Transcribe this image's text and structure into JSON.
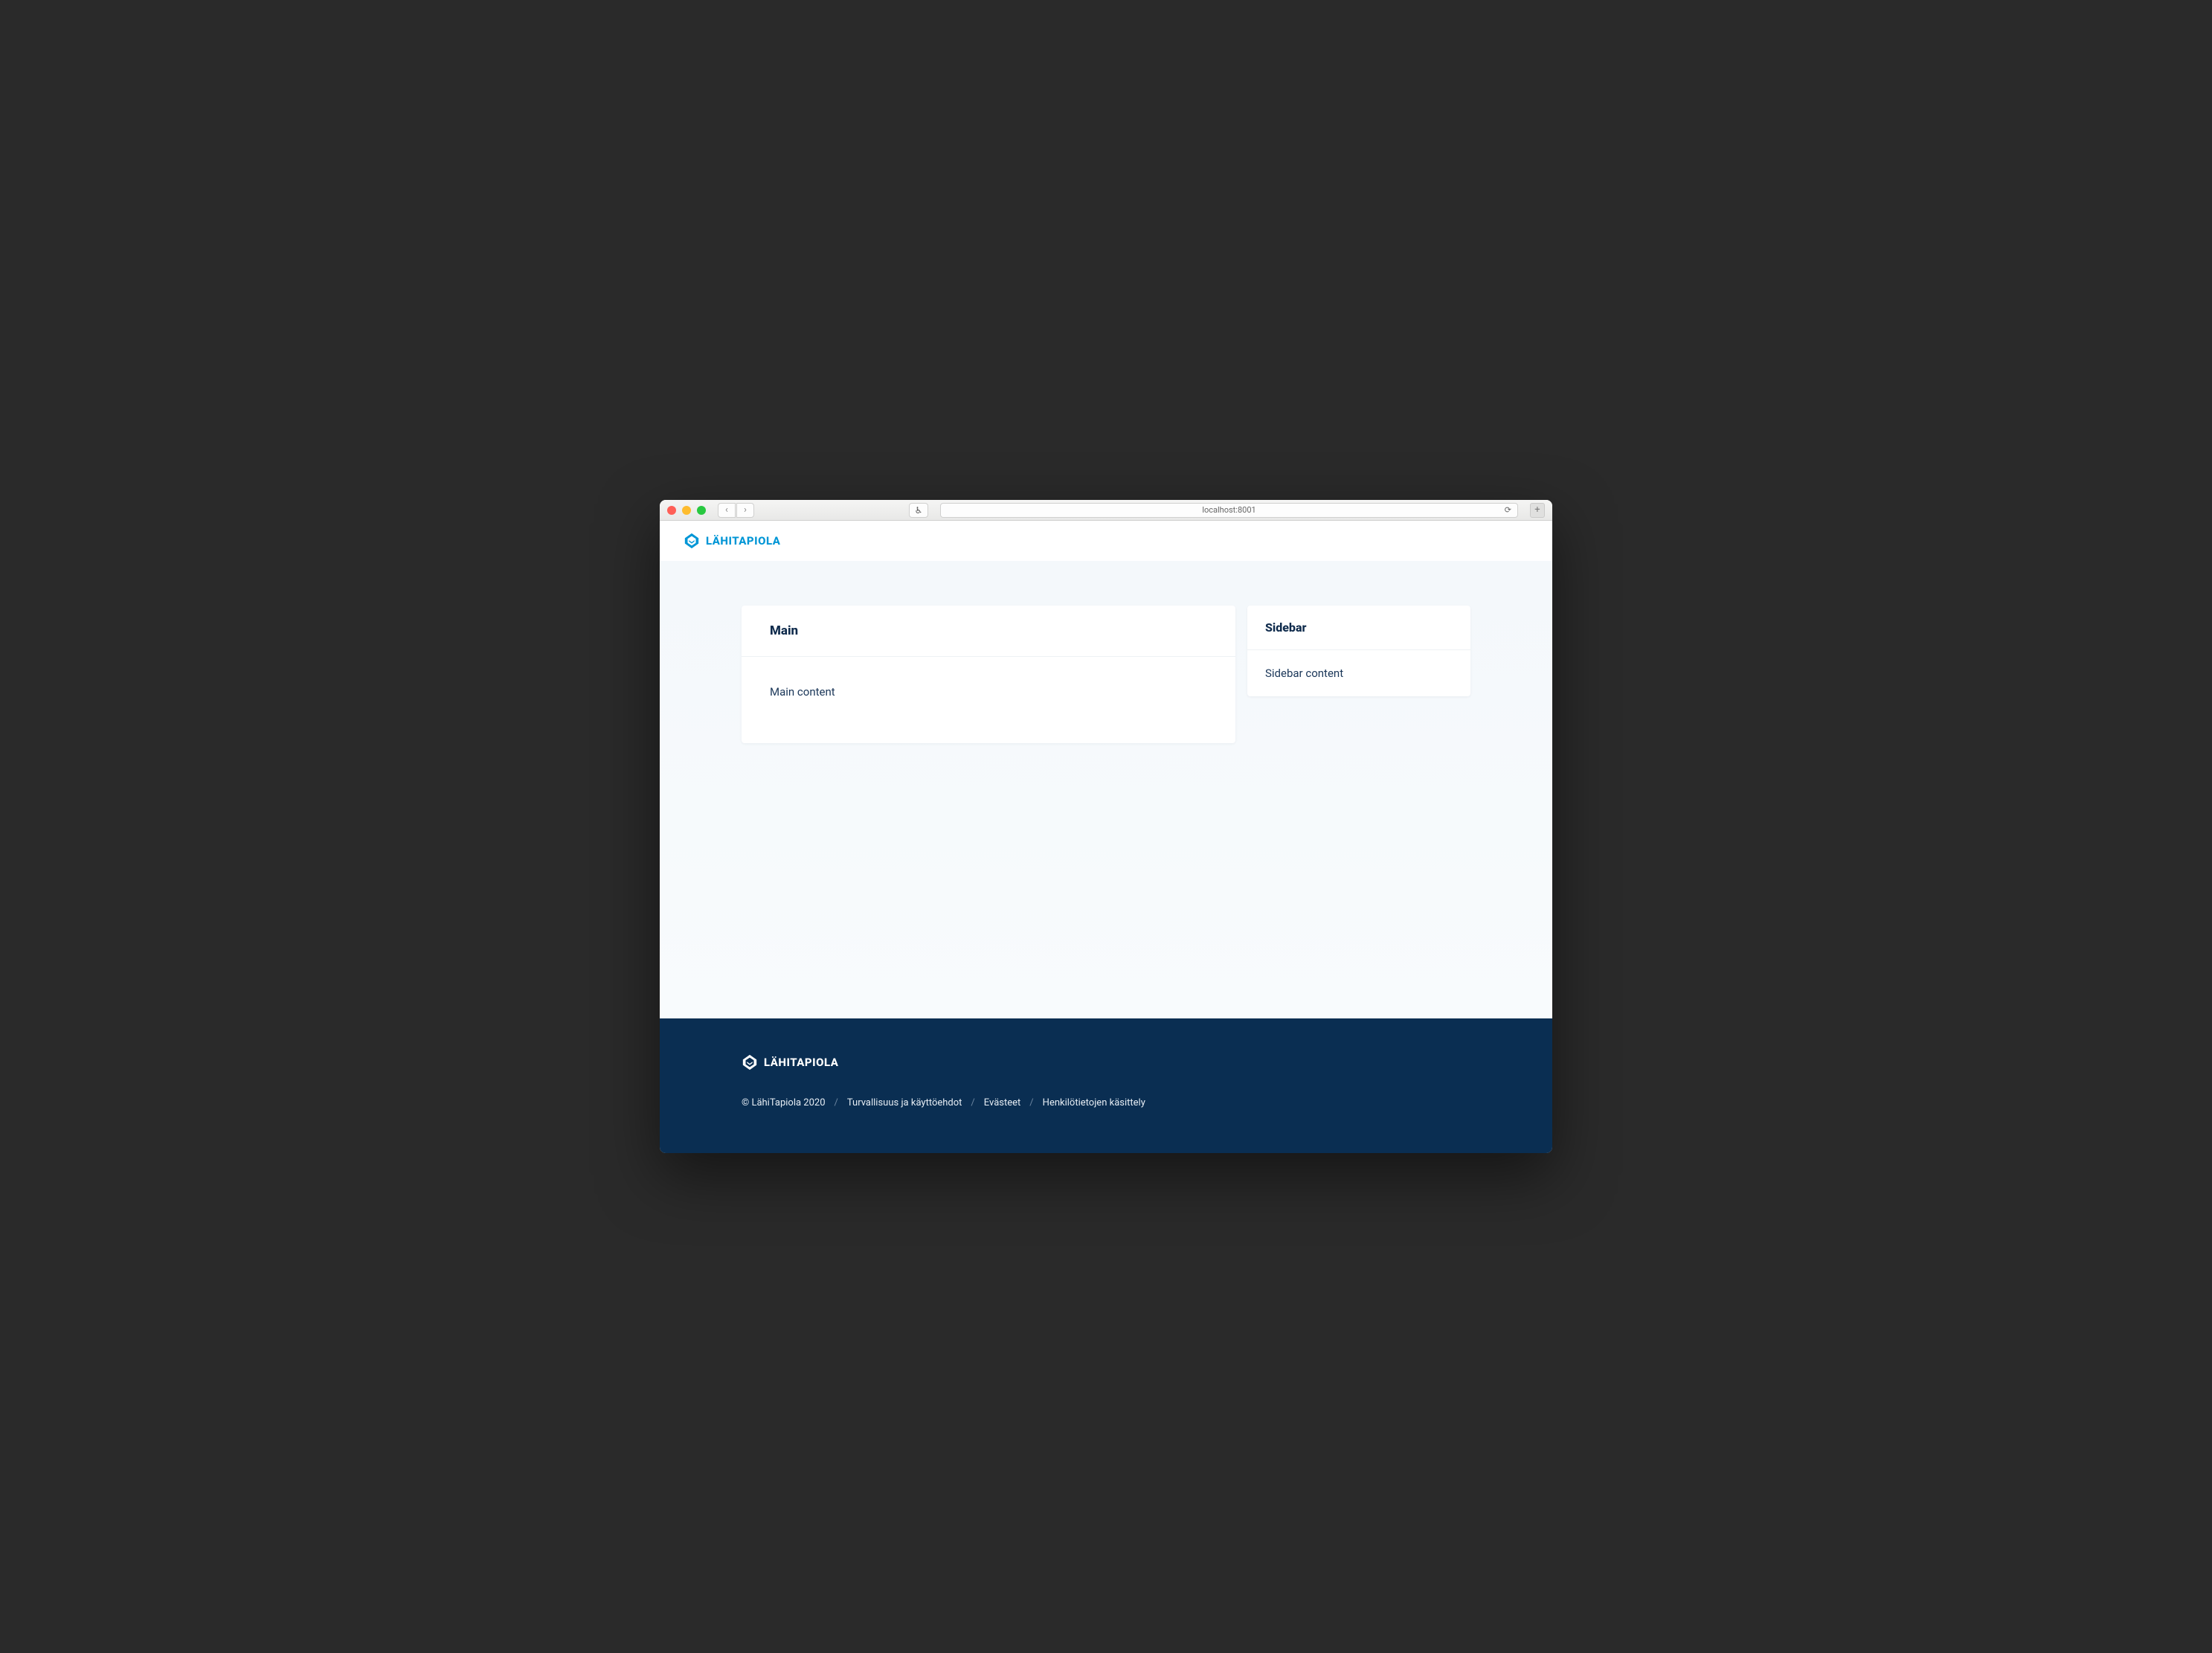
{
  "browser": {
    "url": "localhost:8001",
    "a11y_label": "♿︎",
    "back": "‹",
    "forward": "›",
    "reload": "⟳",
    "newtab": "+"
  },
  "brand": {
    "name": "LÄHITAPIOLA",
    "accent_color": "#0096d6",
    "footer_bg": "#0a2e52"
  },
  "main": {
    "title": "Main",
    "content": "Main content"
  },
  "sidebar": {
    "title": "Sidebar",
    "content": "Sidebar content"
  },
  "footer": {
    "copyright": "© LähiTapiola 2020",
    "links": [
      "Turvallisuus ja käyttöehdot",
      "Evästeet",
      "Henkilötietojen käsittely"
    ],
    "separator": "/"
  }
}
